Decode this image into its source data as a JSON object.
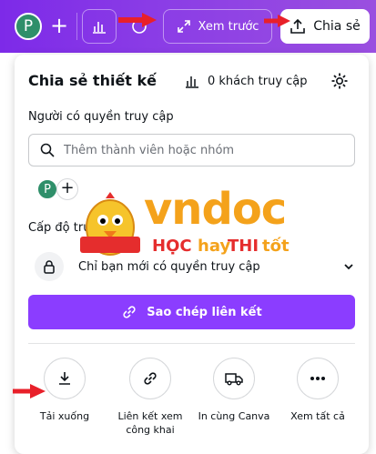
{
  "topbar": {
    "avatar_letter": "P",
    "add_symbol": "+",
    "preview_label": "Xem trước",
    "share_label": "Chia sẻ"
  },
  "panel": {
    "title": "Chia sẻ thiết kế",
    "visitors": "0 khách truy cập",
    "access_label": "Người có quyền truy cập",
    "search_placeholder": "Thêm thành viên hoặc nhóm",
    "member_letter": "P",
    "add_member_symbol": "+",
    "level_label": "Cấp độ truy cập",
    "level_value": "Chỉ bạn mới có quyền truy cập",
    "copy_link_label": "Sao chép liên kết"
  },
  "actions": [
    {
      "label": "Tải xuống",
      "icon": "download-icon"
    },
    {
      "label": "Liên kết xem công khai",
      "icon": "link-icon"
    },
    {
      "label": "In cùng Canva",
      "icon": "truck-icon"
    },
    {
      "label": "Xem tất cả",
      "icon": "more-icon"
    }
  ],
  "watermark": {
    "brand": "vndoc",
    "slogan_1": "HỌC",
    "slogan_2": "hay",
    "slogan_3": "THI",
    "slogan_4": "tốt"
  },
  "colors": {
    "topbar": "#7d2ae8",
    "primary_button": "#8b3dff",
    "annotation_arrow": "#e8202a"
  }
}
